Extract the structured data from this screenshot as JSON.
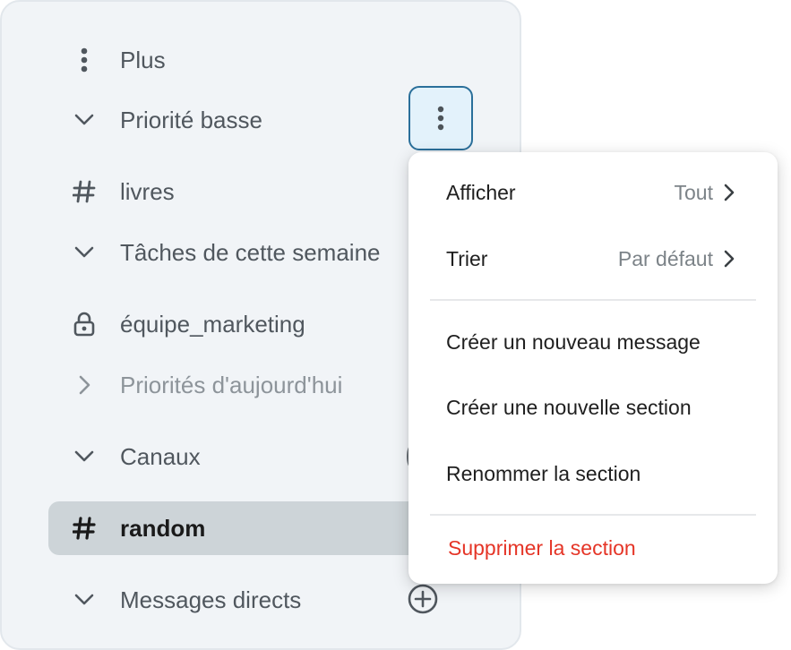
{
  "sidebar": {
    "items": [
      {
        "label": "Plus",
        "icon": "more-vertical-icon"
      },
      {
        "label": "Priorité basse",
        "icon": "chevron-down-icon"
      },
      {
        "label": "livres",
        "icon": "hash-icon"
      },
      {
        "label": "Tâches de cette semaine",
        "icon": "chevron-down-icon"
      },
      {
        "label": "équipe_marketing",
        "icon": "lock-icon"
      },
      {
        "label": "Priorités d'aujourd'hui",
        "icon": "chevron-right-icon"
      },
      {
        "label": "Canaux",
        "icon": "chevron-down-icon"
      },
      {
        "label": "random",
        "icon": "hash-icon"
      },
      {
        "label": "Messages directs",
        "icon": "chevron-down-icon"
      }
    ]
  },
  "context_menu": {
    "show": {
      "label": "Afficher",
      "value": "Tout"
    },
    "sort": {
      "label": "Trier",
      "value": "Par défaut"
    },
    "new_message": "Créer un nouveau message",
    "new_section": "Créer une nouvelle section",
    "rename_section": "Renommer la section",
    "delete_section": "Supprimer la section"
  },
  "colors": {
    "accent_border": "#2a6f9a",
    "danger": "#e53527",
    "selected_row": "#cdd4d8",
    "sidebar_bg": "#f1f4f7"
  }
}
